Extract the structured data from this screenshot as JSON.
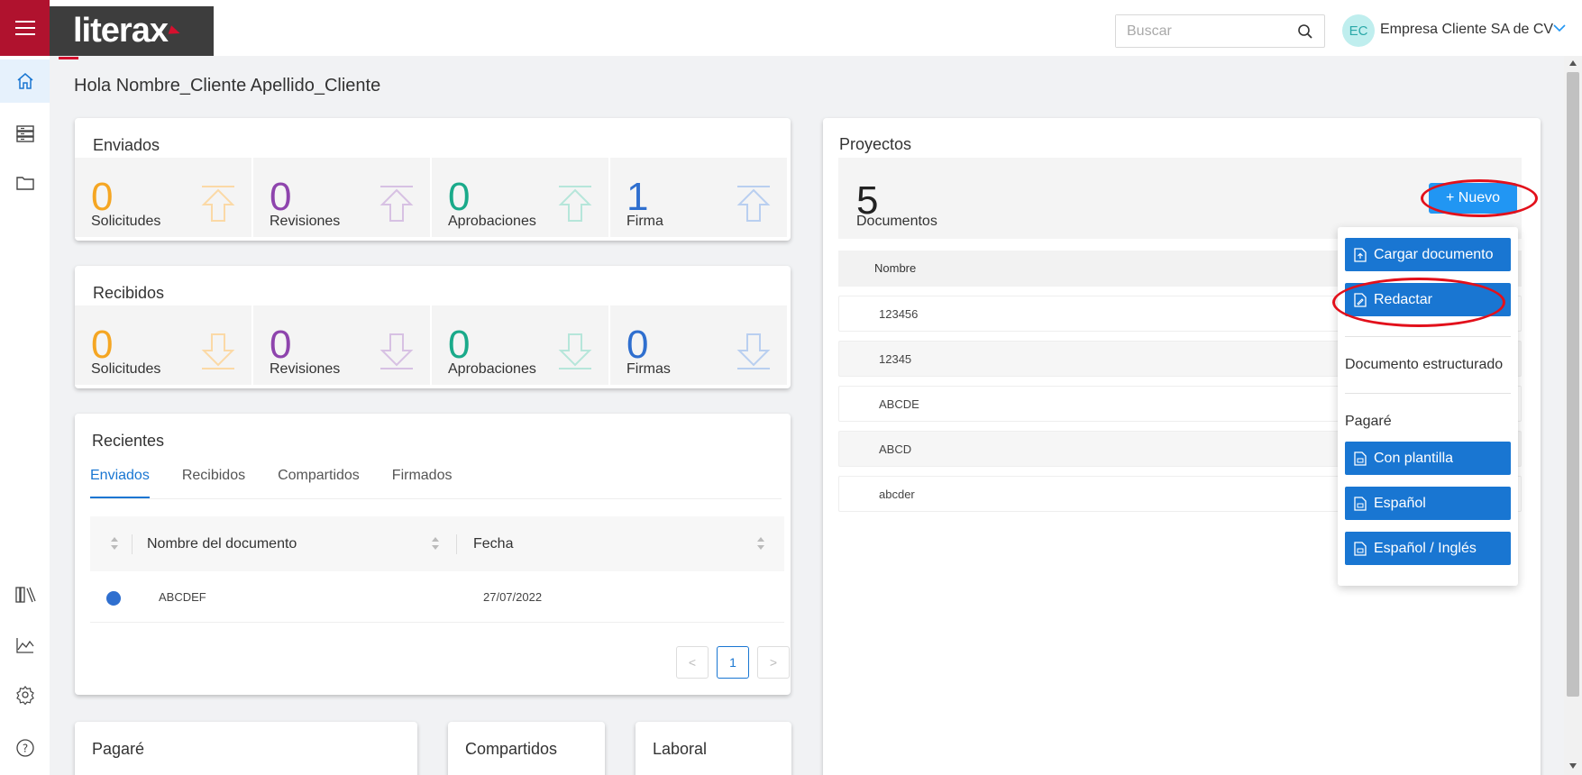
{
  "header": {
    "logo_text": "literax",
    "search_placeholder": "Buscar",
    "avatar_initials": "EC",
    "company_name": "Empresa Cliente SA de CV"
  },
  "sidebar": {
    "top_icons": [
      "home-icon",
      "table-icon",
      "folder-icon"
    ],
    "bottom_icons": [
      "library-icon",
      "chart-icon",
      "gear-icon",
      "help-icon"
    ]
  },
  "greeting": "Hola Nombre_Cliente Apellido_Cliente",
  "enviados": {
    "title": "Enviados",
    "stats": [
      {
        "value": "0",
        "label": "Solicitudes",
        "color": "#f5a623"
      },
      {
        "value": "0",
        "label": "Revisiones",
        "color": "#8e44ad"
      },
      {
        "value": "0",
        "label": "Aprobaciones",
        "color": "#1aaa8a"
      },
      {
        "value": "1",
        "label": "Firma",
        "color": "#2f6fcf"
      }
    ]
  },
  "recibidos": {
    "title": "Recibidos",
    "stats": [
      {
        "value": "0",
        "label": "Solicitudes",
        "color": "#f5a623"
      },
      {
        "value": "0",
        "label": "Revisiones",
        "color": "#8e44ad"
      },
      {
        "value": "0",
        "label": "Aprobaciones",
        "color": "#1aaa8a"
      },
      {
        "value": "0",
        "label": "Firmas",
        "color": "#2f6fcf"
      }
    ]
  },
  "recientes": {
    "title": "Recientes",
    "tabs": [
      "Enviados",
      "Recibidos",
      "Compartidos",
      "Firmados"
    ],
    "columns": [
      "Nombre del documento",
      "Fecha"
    ],
    "rows": [
      {
        "name": "ABCDEF",
        "date": "27/07/2022"
      }
    ],
    "page": "1",
    "prev": "<",
    "next": ">"
  },
  "bottom_cards": [
    "Pagaré",
    "Compartidos",
    "Laboral"
  ],
  "proyectos": {
    "title": "Proyectos",
    "count": "5",
    "count_label": "Documentos",
    "new_button": "+ Nuevo",
    "list_header": "Nombre",
    "items": [
      "123456",
      "12345",
      "ABCDE",
      "ABCD",
      "abcder"
    ]
  },
  "dropdown": {
    "cargar": "Cargar documento",
    "redactar": "Redactar",
    "estructurado": "Documento estructurado",
    "pagare": "Pagaré",
    "con_plantilla": "Con plantilla",
    "espanol": "Español",
    "espanol_ingles": "Español / Inglés"
  }
}
